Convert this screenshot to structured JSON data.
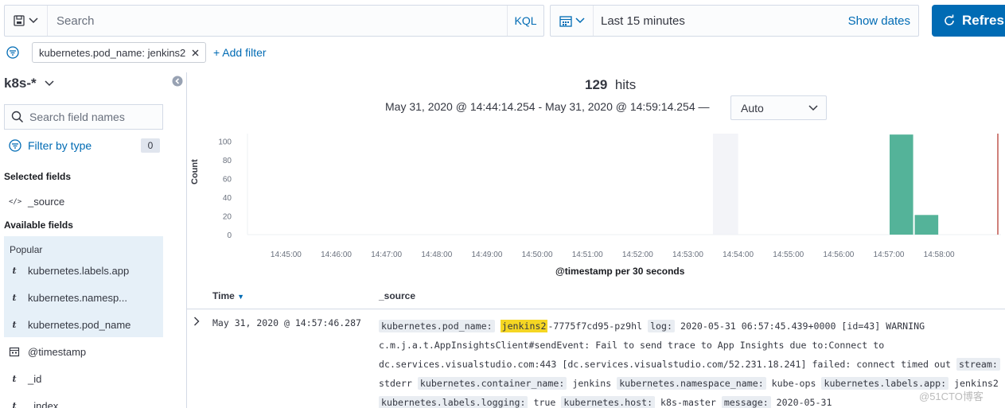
{
  "query_bar": {
    "saved_query_icon": "disk-icon",
    "search_placeholder": "Search",
    "language": "KQL"
  },
  "time_picker": {
    "calendar_icon": "calendar-icon",
    "range": "Last 15 minutes",
    "show_dates": "Show dates"
  },
  "refresh_label": "Refresh",
  "filters": {
    "active": "kubernetes.pod_name: jenkins2",
    "add_label": "+ Add filter"
  },
  "sidebar": {
    "index_pattern": "k8s-*",
    "field_search_placeholder": "Search field names",
    "filter_by_type": "Filter by type",
    "filter_count": "0",
    "selected_title": "Selected fields",
    "selected": [
      {
        "token": "</>",
        "name": "_source"
      }
    ],
    "available_title": "Available fields",
    "popular_title": "Popular",
    "popular": [
      {
        "token": "t",
        "name": "kubernetes.labels.app"
      },
      {
        "token": "t",
        "name": "kubernetes.namesp..."
      },
      {
        "token": "t",
        "name": "kubernetes.pod_name"
      }
    ],
    "others": [
      {
        "token": "cal",
        "name": "@timestamp"
      },
      {
        "token": "t",
        "name": "_id"
      },
      {
        "token": "t",
        "name": "_index"
      }
    ]
  },
  "hits": {
    "count": "129",
    "label": "hits"
  },
  "date_range": {
    "from": "May 31, 2020 @ 14:44:14.254",
    "sep": "-",
    "to": "May 31, 2020 @ 14:59:14.254 —",
    "interval": "Auto"
  },
  "chart_data": {
    "type": "bar",
    "title": "",
    "xlabel": "@timestamp per 30 seconds",
    "ylabel": "Count",
    "ylim": [
      0,
      108
    ],
    "yticks": [
      0,
      20,
      40,
      60,
      80,
      100
    ],
    "xticks": [
      "14:45:00",
      "14:46:00",
      "14:47:00",
      "14:48:00",
      "14:49:00",
      "14:50:00",
      "14:51:00",
      "14:52:00",
      "14:53:00",
      "14:54:00",
      "14:55:00",
      "14:56:00",
      "14:57:00",
      "14:58:00"
    ],
    "x_start": "14:44:14",
    "x_end": "14:59:14",
    "series": [
      {
        "color": "#54b399",
        "points": [
          {
            "x": "14:57:00",
            "y": 107
          },
          {
            "x": "14:57:30",
            "y": 21
          }
        ]
      }
    ],
    "partial_bucket": {
      "from": "14:53:30",
      "to": "14:54:00"
    },
    "now_marker": "14:59:14",
    "grid": false
  },
  "table": {
    "col_time": "Time",
    "col_source": "_source",
    "rows": [
      {
        "time": "May 31, 2020 @ 14:57:46.287",
        "source": [
          {
            "k": "kubernetes.pod_name:"
          },
          {
            "t": " "
          },
          {
            "h": "jenkins2"
          },
          {
            "t": "-7775f7cd95-pz9hl "
          },
          {
            "k": "log:"
          },
          {
            "t": " 2020-05-31 06:57:45.439+0000 [id=43] WARNING c.m.j.a.t.AppInsightsClient#sendEvent: Fail to send trace to App Insights due to:Connect to dc.services.visualstudio.com:443 [dc.services.visualstudio.com/52.231.18.241] failed: connect timed out "
          },
          {
            "k": "stream:"
          },
          {
            "t": " stderr "
          },
          {
            "k": "kubernetes.container_name:"
          },
          {
            "t": " jenkins "
          },
          {
            "k": "kubernetes.namespace_name:"
          },
          {
            "t": " kube-ops "
          },
          {
            "k": "kubernetes.labels.app:"
          },
          {
            "t": " jenkins2 "
          },
          {
            "k": "kubernetes.labels.logging:"
          },
          {
            "t": " true "
          },
          {
            "k": "kubernetes.host:"
          },
          {
            "t": " k8s-master "
          },
          {
            "k": "message:"
          },
          {
            "t": " 2020-05-31"
          }
        ]
      }
    ]
  },
  "watermark": "@51CTO博客"
}
